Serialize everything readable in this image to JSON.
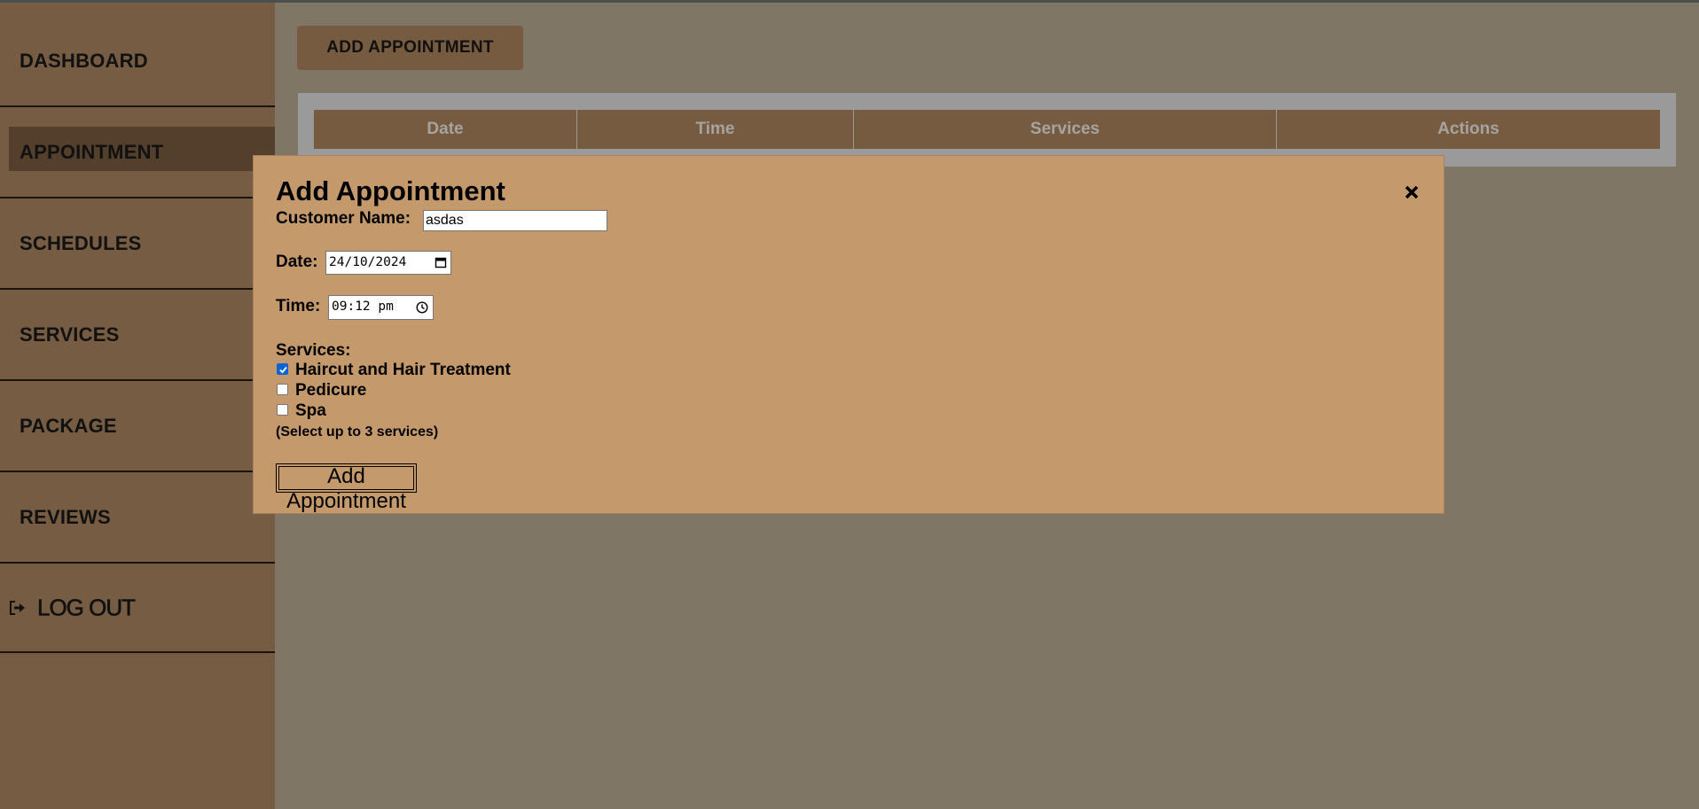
{
  "sidebar": {
    "items": [
      {
        "label": "DASHBOARD"
      },
      {
        "label": "APPOINTMENT"
      },
      {
        "label": "SCHEDULES"
      },
      {
        "label": "SERVICES"
      },
      {
        "label": "PACKAGE"
      },
      {
        "label": "REVIEWS"
      },
      {
        "label": "LOG OUT",
        "icon": "logout-icon"
      }
    ],
    "active": "APPOINTMENT"
  },
  "main": {
    "add_button_label": "ADD APPOINTMENT",
    "table": {
      "headers": [
        "Date",
        "Time",
        "Services",
        "Actions"
      ],
      "rows": []
    }
  },
  "modal": {
    "title": "Add Appointment",
    "close_icon": "close-icon",
    "customer_name_label": "Customer Name:",
    "customer_name_value": "asdas",
    "date_label": "Date:",
    "date_value": "24/10/2024",
    "time_label": "Time:",
    "time_value": "09:12 pm",
    "services_label": "Services:",
    "services": [
      {
        "label": "Haircut and Hair Treatment",
        "checked": true
      },
      {
        "label": "Pedicure",
        "checked": false
      },
      {
        "label": "Spa",
        "checked": false
      }
    ],
    "hint": "(Select up to 3 services)",
    "submit_label": "Add Appointment"
  },
  "colors": {
    "sidebar_bg": "#755c42",
    "main_bg": "#7f7666",
    "modal_bg": "#c49a6c",
    "active_item": "#543f2d",
    "checkbox_checked": "#0b64d2"
  }
}
